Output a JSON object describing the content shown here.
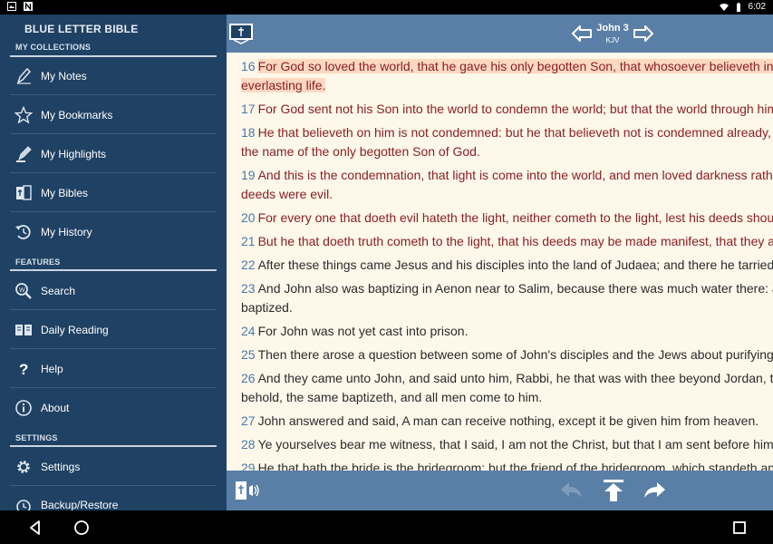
{
  "status_bar": {
    "time": "6:02"
  },
  "drawer": {
    "app_title": "BLUE LETTER BIBLE",
    "sections": {
      "collections": "MY COLLECTIONS",
      "features": "FEATURES",
      "settings": "SETTINGS"
    },
    "items": [
      {
        "label": "My Notes",
        "icon": "pen-icon"
      },
      {
        "label": "My Bookmarks",
        "icon": "star-icon"
      },
      {
        "label": "My Highlights",
        "icon": "highlighter-icon"
      },
      {
        "label": "My Bibles",
        "icon": "bibles-icon"
      },
      {
        "label": "My History",
        "icon": "history-icon"
      },
      {
        "label": "Search",
        "icon": "search-icon"
      },
      {
        "label": "Daily Reading",
        "icon": "book-open-icon"
      },
      {
        "label": "Help",
        "icon": "question-icon"
      },
      {
        "label": "About",
        "icon": "info-icon"
      },
      {
        "label": "Settings",
        "icon": "gear-icon"
      },
      {
        "label": "Backup/Restore",
        "icon": "backup-icon"
      }
    ]
  },
  "toolbar": {
    "book": "John 3",
    "version": "KJV"
  },
  "verses": [
    {
      "num": "16",
      "lines": [
        "For God so loved the world, that he gave his only begotten Son, that whosoever believeth in him should not perish, but have",
        "everlasting life."
      ],
      "red": true,
      "highlight": true
    },
    {
      "num": "17",
      "lines": [
        "For God sent not his Son into the world to condemn the world; but that the world through him might be saved."
      ],
      "red": true
    },
    {
      "num": "18",
      "lines": [
        "He that believeth on him is not condemned: but he that believeth not is condemned already, because he hath not believed in",
        "the name of the only begotten Son of God."
      ],
      "red": true
    },
    {
      "num": "19",
      "lines": [
        "And this is the condemnation, that light is come into the world, and men loved darkness rather than light, because their",
        "deeds were evil."
      ],
      "red": true
    },
    {
      "num": "20",
      "lines": [
        "For every one that doeth evil hateth the light, neither cometh to the light, lest his deeds should be reproved."
      ],
      "red": true
    },
    {
      "num": "21",
      "lines": [
        "But he that doeth truth cometh to the light, that his deeds may be made manifest, that they are wrought in God."
      ],
      "red": true
    },
    {
      "num": "22",
      "lines": [
        "After these things came Jesus and his disciples into the land of Judaea; and there he tarried with them, and baptized."
      ]
    },
    {
      "num": "23",
      "lines": [
        "And John also was baptizing in Aenon near to Salim, because there was much water there: and they came, and were",
        "baptized."
      ]
    },
    {
      "num": "24",
      "lines": [
        "For John was not yet cast into prison."
      ]
    },
    {
      "num": "25",
      "lines": [
        "Then there arose a question between some of John's disciples and the Jews about purifying."
      ]
    },
    {
      "num": "26",
      "lines": [
        "And they came unto John, and said unto him, Rabbi, he that was with thee beyond Jordan, to whom thou barest witness,",
        "behold, the same baptizeth, and all men come to him."
      ]
    },
    {
      "num": "27",
      "lines": [
        "John answered and said, A man can receive nothing, except it be given him from heaven."
      ]
    },
    {
      "num": "28",
      "lines": [
        "Ye yourselves bear me witness, that I said, I am not the Christ, but that I am sent before him."
      ]
    },
    {
      "num": "29",
      "lines": [
        "He that hath the bride is the bridegroom: but the friend of the bridegroom, which standeth and heareth him, rejoiceth greatly"
      ]
    }
  ],
  "colors": {
    "drawer_bg": "#1f4163",
    "toolbar_bg": "#5a7fa6",
    "reader_bg": "#fdf8ea",
    "red_letter": "#8b1e25",
    "highlight": "#fdd9c2",
    "verse_num": "#4b78a8"
  }
}
